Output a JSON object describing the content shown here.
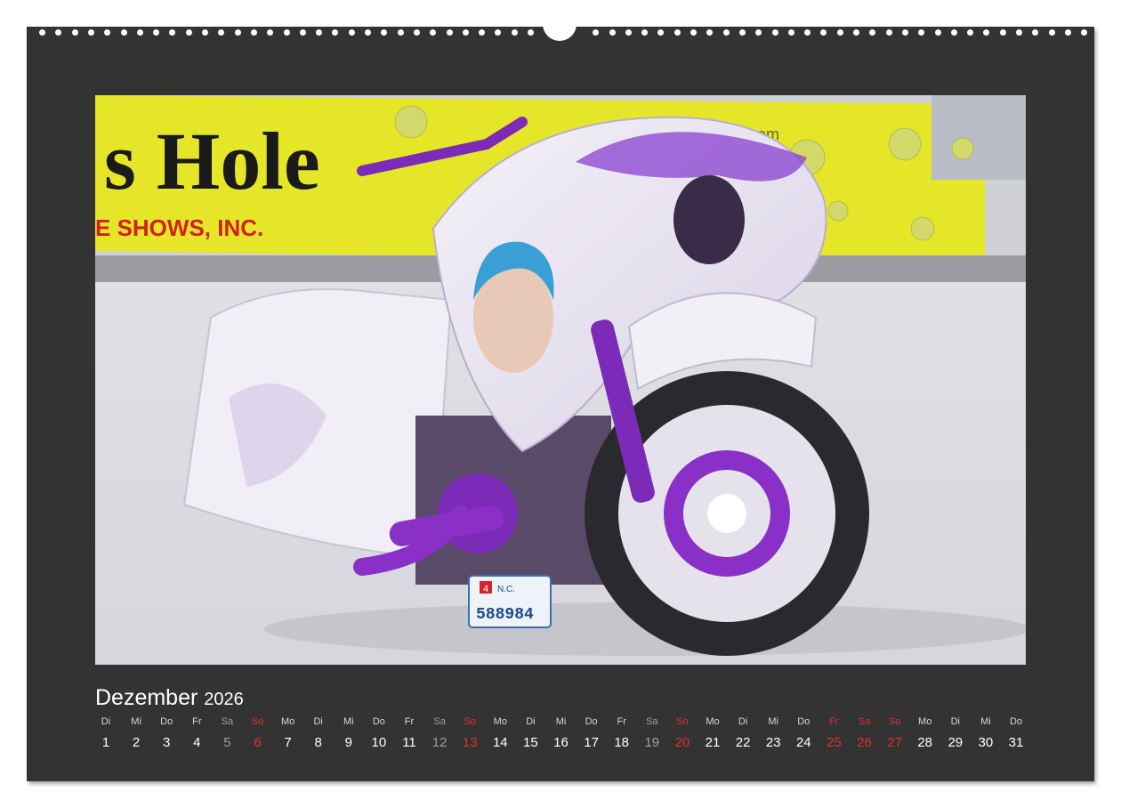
{
  "calendar": {
    "month": "Dezember",
    "year": "2026",
    "days": [
      {
        "wd": "Di",
        "n": "1",
        "t": "weekday"
      },
      {
        "wd": "Mi",
        "n": "2",
        "t": "weekday"
      },
      {
        "wd": "Do",
        "n": "3",
        "t": "weekday"
      },
      {
        "wd": "Fr",
        "n": "4",
        "t": "weekday"
      },
      {
        "wd": "Sa",
        "n": "5",
        "t": "sat"
      },
      {
        "wd": "So",
        "n": "6",
        "t": "red"
      },
      {
        "wd": "Mo",
        "n": "7",
        "t": "weekday"
      },
      {
        "wd": "Di",
        "n": "8",
        "t": "weekday"
      },
      {
        "wd": "Mi",
        "n": "9",
        "t": "weekday"
      },
      {
        "wd": "Do",
        "n": "10",
        "t": "weekday"
      },
      {
        "wd": "Fr",
        "n": "11",
        "t": "weekday"
      },
      {
        "wd": "Sa",
        "n": "12",
        "t": "sat"
      },
      {
        "wd": "So",
        "n": "13",
        "t": "red"
      },
      {
        "wd": "Mo",
        "n": "14",
        "t": "weekday"
      },
      {
        "wd": "Di",
        "n": "15",
        "t": "weekday"
      },
      {
        "wd": "Mi",
        "n": "16",
        "t": "weekday"
      },
      {
        "wd": "Do",
        "n": "17",
        "t": "weekday"
      },
      {
        "wd": "Fr",
        "n": "18",
        "t": "weekday"
      },
      {
        "wd": "Sa",
        "n": "19",
        "t": "sat"
      },
      {
        "wd": "So",
        "n": "20",
        "t": "red"
      },
      {
        "wd": "Mo",
        "n": "21",
        "t": "weekday"
      },
      {
        "wd": "Di",
        "n": "22",
        "t": "weekday"
      },
      {
        "wd": "Mi",
        "n": "23",
        "t": "weekday"
      },
      {
        "wd": "Do",
        "n": "24",
        "t": "weekday"
      },
      {
        "wd": "Fr",
        "n": "25",
        "t": "red"
      },
      {
        "wd": "Sa",
        "n": "26",
        "t": "red"
      },
      {
        "wd": "So",
        "n": "27",
        "t": "red"
      },
      {
        "wd": "Mo",
        "n": "28",
        "t": "weekday"
      },
      {
        "wd": "Di",
        "n": "29",
        "t": "weekday"
      },
      {
        "wd": "Mi",
        "n": "30",
        "t": "weekday"
      },
      {
        "wd": "Do",
        "n": "31",
        "t": "weekday"
      }
    ]
  },
  "photo": {
    "banner_text": "s Hole",
    "banner_subtext": "E SHOWS, INC.",
    "banner_url_fragment": ".com",
    "plate_state": "N.C.",
    "plate_month": "4",
    "plate_number": "588984"
  },
  "colors": {
    "background": "#333333",
    "weekday": "#ffffff",
    "saturday": "#a0a0a0",
    "holiday": "#e0302a",
    "banner_yellow": "#e6e628",
    "bike_purple": "#7b2bb8"
  }
}
